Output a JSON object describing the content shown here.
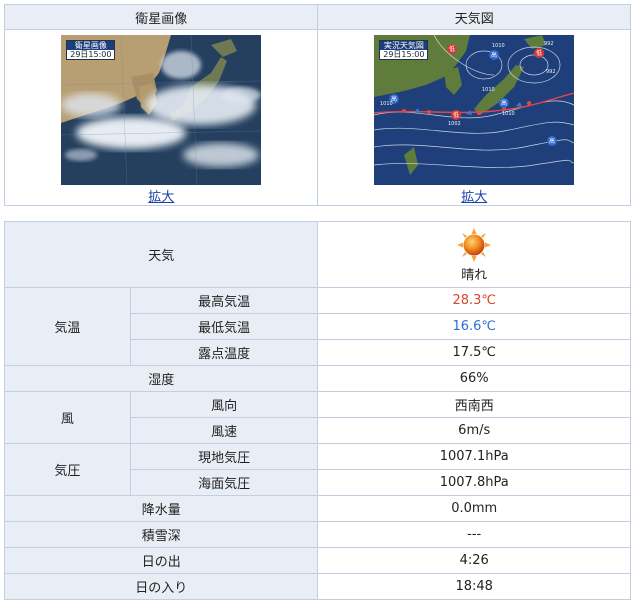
{
  "images": {
    "satellite": {
      "header": "衛星画像",
      "overlay_title": "衛星画像",
      "overlay_time": "29日15:00",
      "link": "拡大"
    },
    "weather_map": {
      "header": "天気図",
      "overlay_title": "実況天気図",
      "overlay_time": "29日15:00",
      "link": "拡大",
      "pressure_labels": [
        "1010",
        "1010",
        "992",
        "1002",
        "1010",
        "992",
        "1010"
      ]
    }
  },
  "weather": {
    "label": "天気",
    "icon": "sun-icon",
    "value": "晴れ"
  },
  "temperature": {
    "group": "気温",
    "rows": [
      {
        "label": "最高気温",
        "value": "28.3℃",
        "color": "#d6482a"
      },
      {
        "label": "最低気温",
        "value": "16.6℃",
        "color": "#2a6fd6"
      },
      {
        "label": "露点温度",
        "value": "17.5℃",
        "color": "#222222"
      }
    ]
  },
  "humidity": {
    "label": "湿度",
    "value": "66%"
  },
  "wind": {
    "group": "風",
    "rows": [
      {
        "label": "風向",
        "value": "西南西"
      },
      {
        "label": "風速",
        "value": "6m/s"
      }
    ]
  },
  "pressure": {
    "group": "気圧",
    "rows": [
      {
        "label": "現地気圧",
        "value": "1007.1hPa"
      },
      {
        "label": "海面気圧",
        "value": "1007.8hPa"
      }
    ]
  },
  "precipitation": {
    "label": "降水量",
    "value": "0.0mm"
  },
  "snow_depth": {
    "label": "積雪深",
    "value": "---"
  },
  "sunrise": {
    "label": "日の出",
    "value": "4:26"
  },
  "sunset": {
    "label": "日の入り",
    "value": "18:48"
  }
}
